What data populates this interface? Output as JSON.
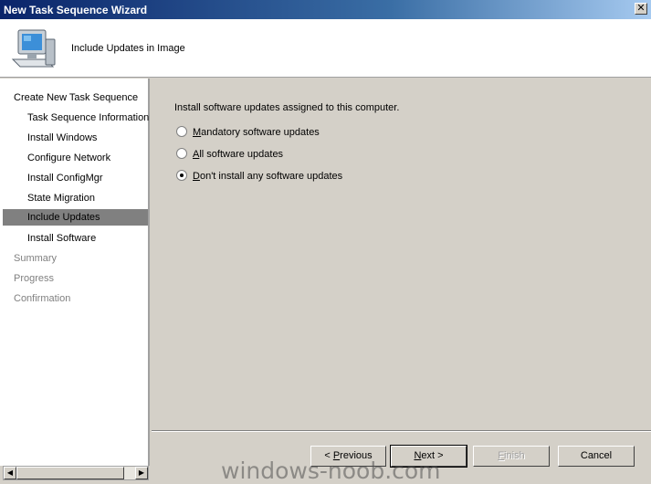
{
  "window": {
    "title": "New Task Sequence Wizard",
    "close_glyph": "✕"
  },
  "header": {
    "title": "Include Updates in Image",
    "icon": "computer-icon"
  },
  "sidebar": {
    "items": [
      {
        "label": "Create New Task Sequence",
        "state": "active"
      },
      {
        "label": "Task Sequence Information",
        "state": "active"
      },
      {
        "label": "Install Windows",
        "state": "active"
      },
      {
        "label": "Configure Network",
        "state": "active"
      },
      {
        "label": "Install ConfigMgr",
        "state": "active"
      },
      {
        "label": "State Migration",
        "state": "active"
      },
      {
        "label": "Include Updates",
        "state": "selected"
      },
      {
        "label": "Install Software",
        "state": "active"
      },
      {
        "label": "Summary",
        "state": "disabled"
      },
      {
        "label": "Progress",
        "state": "disabled"
      },
      {
        "label": "Confirmation",
        "state": "disabled"
      }
    ]
  },
  "main": {
    "prompt": "Install software updates assigned to this computer.",
    "options": [
      {
        "accel": "M",
        "rest": "andatory software updates",
        "checked": false
      },
      {
        "accel": "A",
        "rest": "ll software updates",
        "checked": false
      },
      {
        "accel": "D",
        "rest": "on't install any software updates",
        "checked": true
      }
    ]
  },
  "buttons": {
    "previous": {
      "pre": "< ",
      "accel": "P",
      "rest": "revious"
    },
    "next": {
      "accel": "N",
      "rest": "ext >"
    },
    "finish": {
      "accel": "F",
      "rest": "inish"
    },
    "cancel": {
      "label": "Cancel"
    }
  },
  "scrollbar": {
    "left_arrow": "◀",
    "right_arrow": "▶"
  },
  "watermark": "windows-noob.com"
}
